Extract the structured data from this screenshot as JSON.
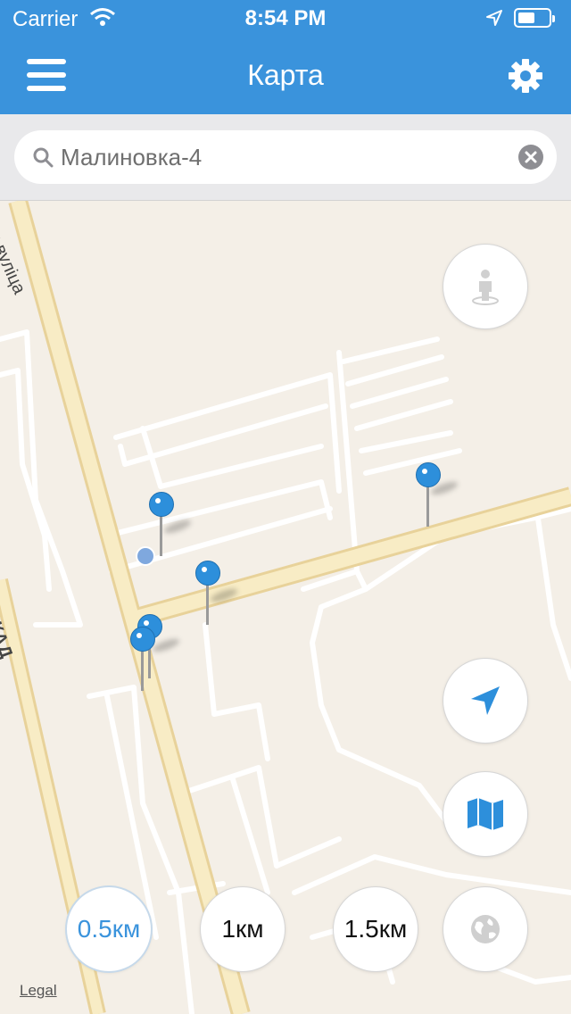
{
  "status_bar": {
    "carrier": "Carrier",
    "time": "8:54 PM"
  },
  "nav": {
    "title": "Карта",
    "menu_icon": "hamburger-menu-icon",
    "settings_icon": "gear-icon"
  },
  "search": {
    "value": "Малиновка-4",
    "placeholder": ""
  },
  "map": {
    "street_labels": [
      "кая вуліца",
      "МКАД"
    ],
    "legal": "Legal"
  },
  "distance_buttons": [
    {
      "label": "0.5км",
      "active": true
    },
    {
      "label": "1км",
      "active": false
    },
    {
      "label": "1.5км",
      "active": false
    }
  ],
  "colors": {
    "accent": "#3a93dc",
    "pin": "#2d8fdb",
    "map_bg": "#f4efe7",
    "road_major": "#f5e4b0"
  }
}
